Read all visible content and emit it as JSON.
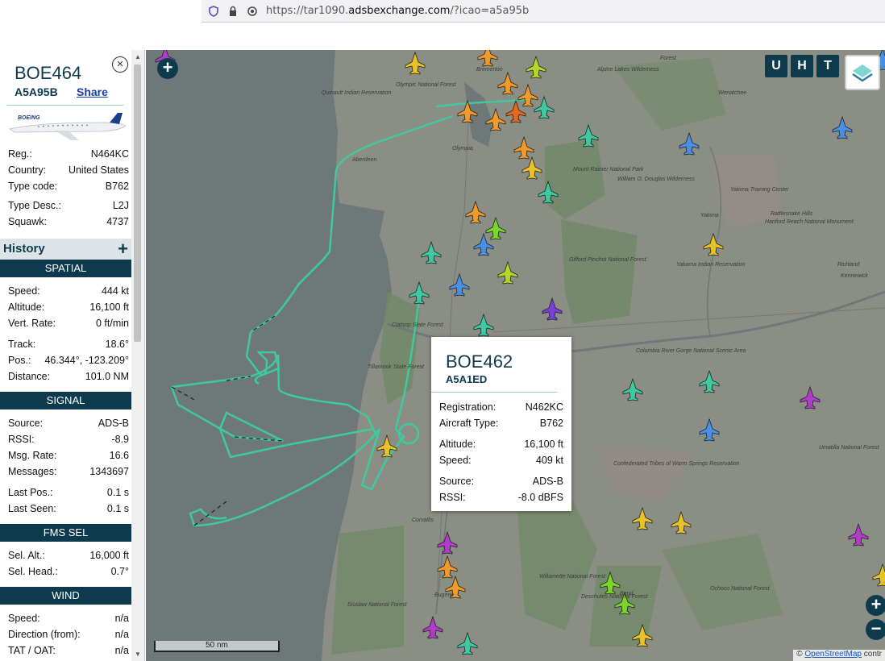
{
  "browser": {
    "url_prefix": "https://tar1090.",
    "url_domain": "adsbexchange.com",
    "url_suffix": "/?icao=a5a95b"
  },
  "selected": {
    "callsign": "BOE464",
    "hex": "A5A95B",
    "share_label": "Share",
    "close_icon": "close-icon",
    "logo_text": "BOEING"
  },
  "info": [
    {
      "label": "Reg.:",
      "value": "N464KC"
    },
    {
      "label": "Country:",
      "value": "United States"
    },
    {
      "label": "Type code:",
      "value": "B762"
    },
    {
      "label": "Type Desc.:",
      "value": "L2J"
    },
    {
      "label": "Squawk:",
      "value": "4737"
    }
  ],
  "history_label": "History",
  "history_add": "+",
  "sections": {
    "spatial": "SPATIAL",
    "signal": "SIGNAL",
    "fms": "FMS SEL",
    "wind": "WIND"
  },
  "spatial": [
    {
      "label": "Speed:",
      "value": "444 kt"
    },
    {
      "label": "Altitude:",
      "value": "16,100 ft"
    },
    {
      "label": "Vert. Rate:",
      "value": "0 ft/min"
    },
    {
      "label": "Track:",
      "value": "18.6°"
    },
    {
      "label": "Pos.:",
      "value": "46.344°, -123.209°"
    },
    {
      "label": "Distance:",
      "value": "101.0 NM"
    }
  ],
  "signal": [
    {
      "label": "Source:",
      "value": "ADS-B"
    },
    {
      "label": "RSSI:",
      "value": "-8.9"
    },
    {
      "label": "Msg. Rate:",
      "value": "16.6"
    },
    {
      "label": "Messages:",
      "value": "1343697"
    },
    {
      "label": "Last Pos.:",
      "value": "0.1 s"
    },
    {
      "label": "Last Seen:",
      "value": "0.1 s"
    }
  ],
  "fms": [
    {
      "label": "Sel. Alt.:",
      "value": "16,000 ft"
    },
    {
      "label": "Sel. Head.:",
      "value": "0.7°"
    }
  ],
  "wind": [
    {
      "label": "Speed:",
      "value": "n/a"
    },
    {
      "label": "Direction (from):",
      "value": "n/a"
    },
    {
      "label": "TAT / OAT:",
      "value": "n/a"
    }
  ],
  "map": {
    "buttons": [
      "U",
      "H",
      "T"
    ],
    "zoom_in": "+",
    "zoom_out": "−",
    "add_button": "+",
    "scale_label": "50 nm",
    "attribution_prefix": "© ",
    "attribution_link": "OpenStreetMap",
    "attribution_suffix": " contr",
    "track_color": "#3ec9a0",
    "ocean_color": "#6f7878",
    "land_color": "#8a8d83",
    "places": [
      "Bremerton",
      "Olympic National Forest",
      "Quinault Indian Reservation",
      "Aberdeen",
      "Olympia",
      "Mount Rainier National Park",
      "William O. Douglas Wilderness",
      "Yakima Training Center",
      "Yakima",
      "Rattlesnake Hills",
      "Gifford Pinchot National Forest",
      "Yakama Indian Reservation",
      "Richland",
      "Kennewick",
      "Clatsop State Forest",
      "Tillamook State Forest",
      "Columbia River Gorge National Scenic Area",
      "Confederated Tribes of Warm Springs Reservation",
      "Corvallis",
      "Willamette National Forest",
      "Deschutes National Forest",
      "Ochoco National Forest",
      "Umatilla National Forest",
      "Siuslaw National Forest",
      "Wenatchee",
      "Forest",
      "Alpine Lakes Wilderness",
      "Hanford Reach National Monument",
      "Eugene",
      "Bend"
    ]
  },
  "popup": {
    "callsign": "BOE462",
    "hex": "A5A1ED",
    "rows1": [
      {
        "label": "Registration:",
        "value": "N462KC"
      },
      {
        "label": "Aircraft Type:",
        "value": "B762"
      }
    ],
    "rows2": [
      {
        "label": "Altitude:",
        "value": "16,100 ft"
      },
      {
        "label": "Speed:",
        "value": "409 kt"
      }
    ],
    "rows3": [
      {
        "label": "Source:",
        "value": "ADS-B"
      },
      {
        "label": "RSSI:",
        "value": "-8.0 dBFS"
      }
    ]
  }
}
